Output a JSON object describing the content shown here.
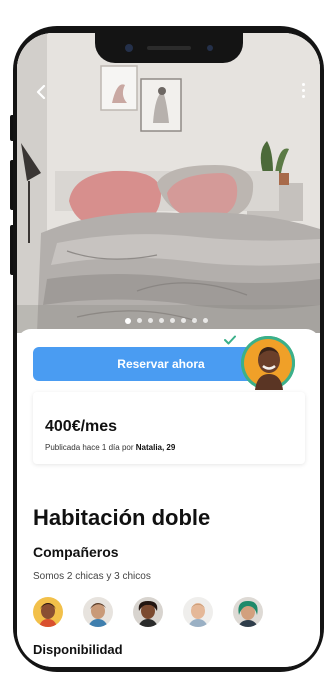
{
  "nav": {
    "back_icon": "chevron-left-icon",
    "more_icon": "more-vertical-icon"
  },
  "gallery": {
    "total_photos": 8,
    "active_index": 0
  },
  "booking": {
    "cta_label": "Reservar ahora",
    "cta_color": "#4a9cf2"
  },
  "listing": {
    "price": "400€/mes",
    "posted_prefix": "Publicada hace 1 día por",
    "host_name": "Natalia, 29",
    "verified_color": "#3bb08a",
    "title": "Habitación doble"
  },
  "roommates": {
    "heading": "Compañeros",
    "description": "Somos 2 chicas y 3 chicos",
    "count": 5
  },
  "availability": {
    "heading": "Disponibilidad"
  }
}
